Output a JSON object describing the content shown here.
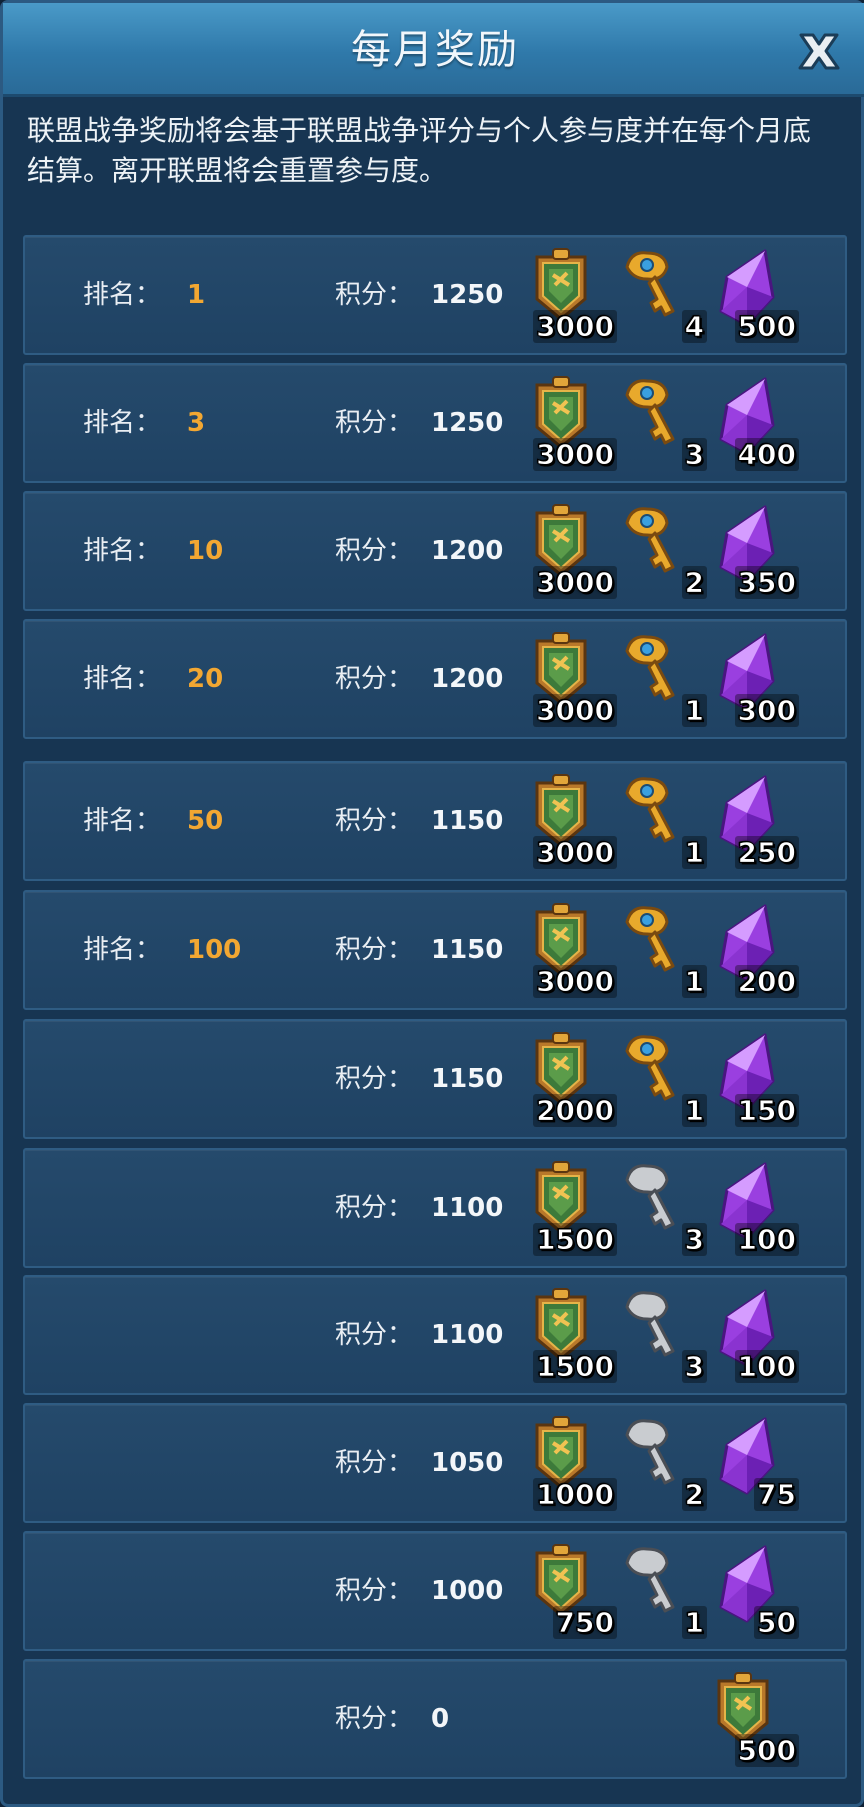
{
  "header": {
    "title": "每月奖励"
  },
  "description": "联盟战争奖励将会基于联盟战争评分与个人参与度并在每个月底结算。离开联盟将会重置参与度。",
  "rank_label": "排名：",
  "score_label": "积分：",
  "rows": [
    {
      "rank": "1",
      "score": "1250",
      "shield": "3000",
      "key_type": "gold",
      "key": "4",
      "crystal": "500"
    },
    {
      "rank": "3",
      "score": "1250",
      "shield": "3000",
      "key_type": "gold",
      "key": "3",
      "crystal": "400"
    },
    {
      "rank": "10",
      "score": "1200",
      "shield": "3000",
      "key_type": "gold",
      "key": "2",
      "crystal": "350"
    },
    {
      "rank": "20",
      "score": "1200",
      "shield": "3000",
      "key_type": "gold",
      "key": "1",
      "crystal": "300"
    },
    {
      "rank": "50",
      "score": "1150",
      "shield": "3000",
      "key_type": "gold",
      "key": "1",
      "crystal": "250"
    },
    {
      "rank": "100",
      "score": "1150",
      "shield": "3000",
      "key_type": "gold",
      "key": "1",
      "crystal": "200"
    },
    {
      "rank": "",
      "score": "1150",
      "shield": "2000",
      "key_type": "gold",
      "key": "1",
      "crystal": "150"
    },
    {
      "rank": "",
      "score": "1100",
      "shield": "1500",
      "key_type": "silver",
      "key": "3",
      "crystal": "100"
    },
    {
      "rank": "",
      "score": "1100",
      "shield": "1500",
      "key_type": "silver",
      "key": "3",
      "crystal": "100"
    },
    {
      "rank": "",
      "score": "1050",
      "shield": "1000",
      "key_type": "silver",
      "key": "2",
      "crystal": "75"
    },
    {
      "rank": "",
      "score": "1000",
      "shield": "750",
      "key_type": "silver",
      "key": "1",
      "crystal": "50"
    },
    {
      "rank": "",
      "score": "0",
      "shield_only": "500"
    }
  ],
  "icons": {
    "close": "close-icon",
    "shield": "alliance-shield-icon",
    "gold_key": "gold-key-icon",
    "silver_key": "silver-key-icon",
    "crystal": "purple-crystal-icon"
  },
  "colors": {
    "rank_value": "#f2a732",
    "header": "#3a88b9",
    "row_bg": "#234769"
  }
}
